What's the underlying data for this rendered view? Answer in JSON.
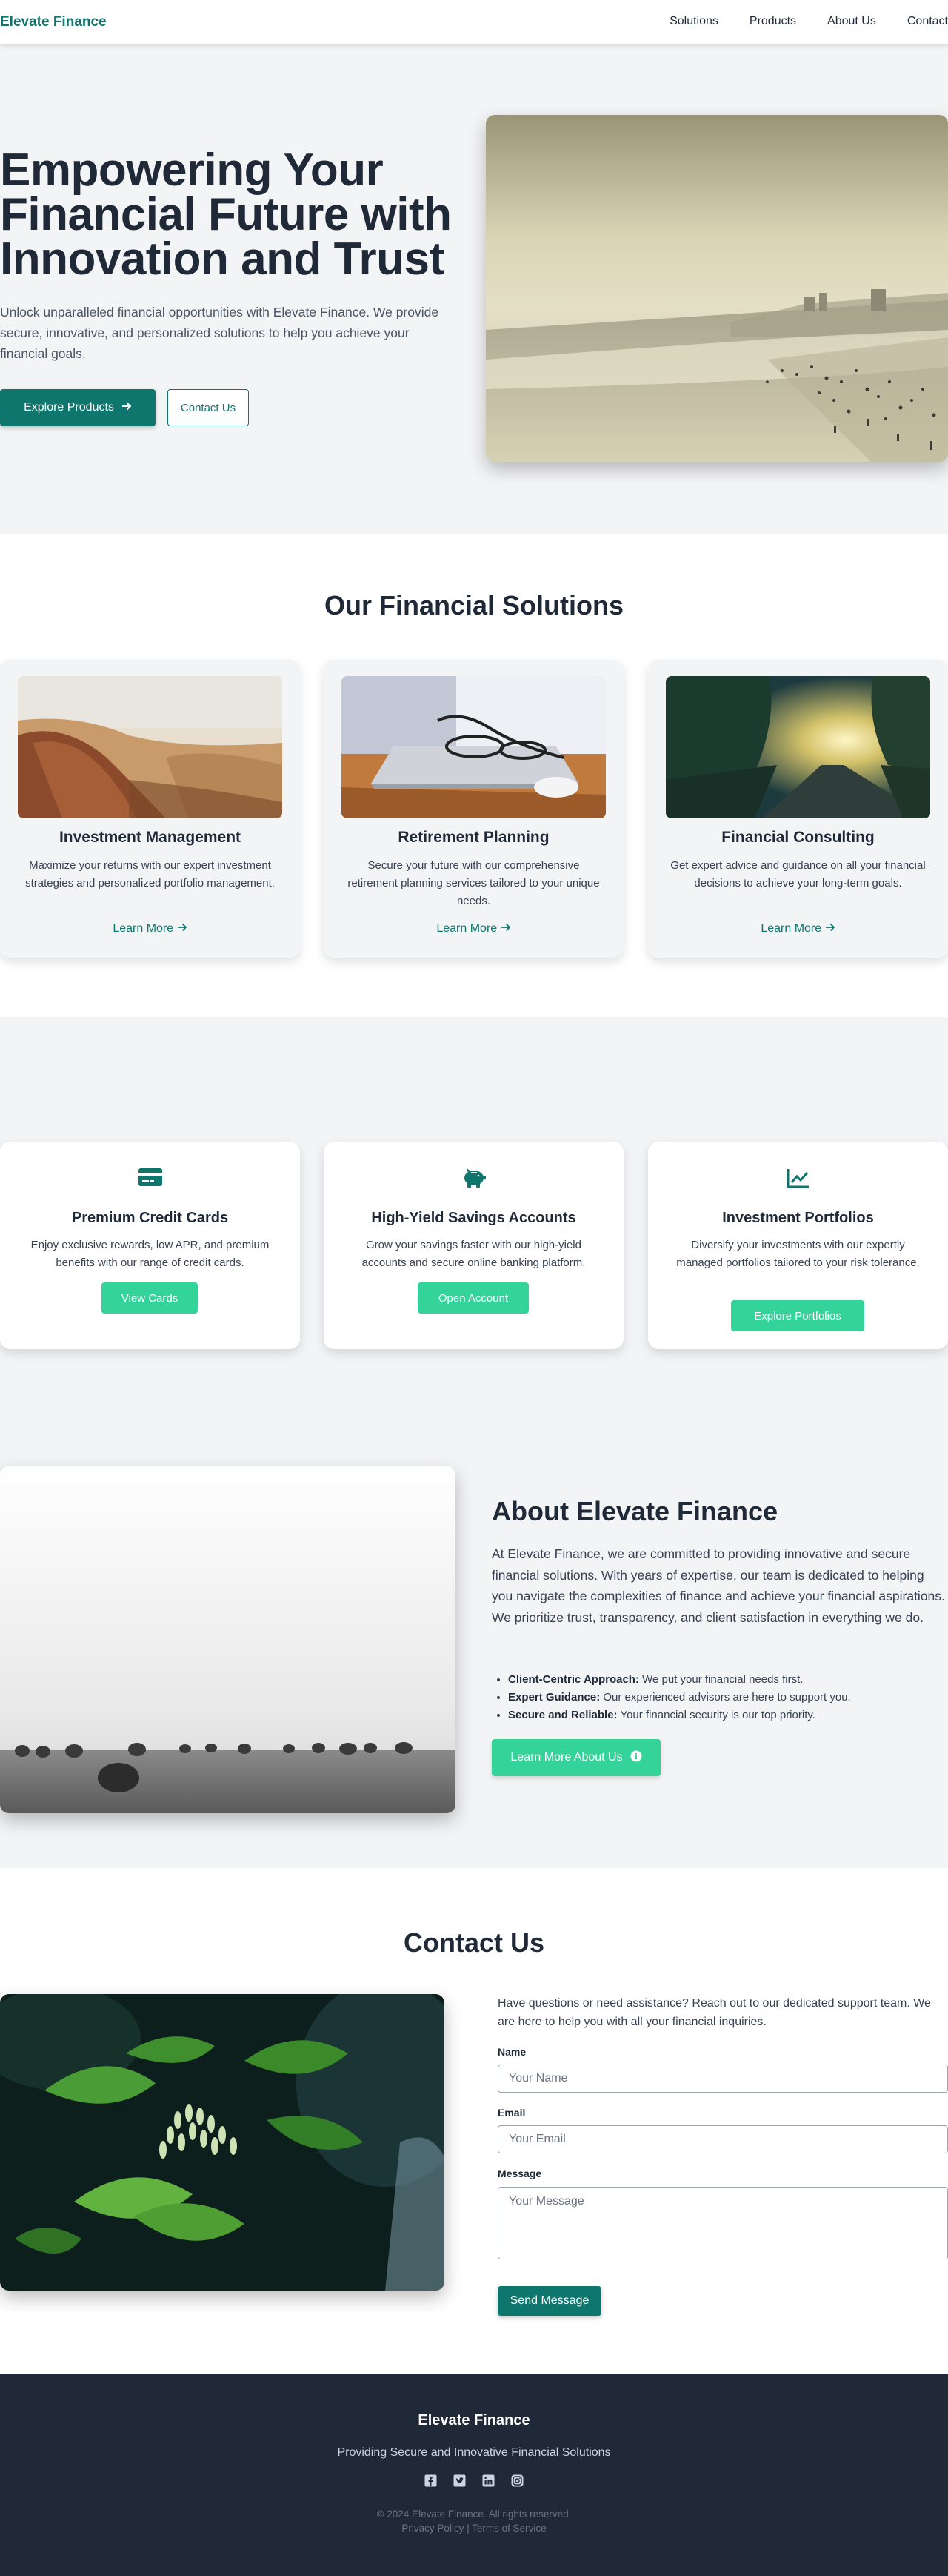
{
  "nav": {
    "brand": "Elevate Finance",
    "links": [
      "Solutions",
      "Products",
      "About Us",
      "Contact"
    ]
  },
  "hero": {
    "title": "Empowering Your Financial Future with Innovation and Trust",
    "subtitle": "Unlock unparalleled financial opportunities with Elevate Finance. We provide secure, innovative, and personalized solutions to help you achieve your financial goals.",
    "primary_button": "Explore Products",
    "secondary_button": "Contact Us"
  },
  "solutions": {
    "title": "Our Financial Solutions",
    "cards": [
      {
        "title": "Investment Management",
        "text": "Maximize your returns with our expert investment strategies and personalized portfolio management.",
        "link": "Learn More"
      },
      {
        "title": "Retirement Planning",
        "text": "Secure your future with our comprehensive retirement planning services tailored to your unique needs.",
        "link": "Learn More"
      },
      {
        "title": "Financial Consulting",
        "text": "Get expert advice and guidance on all your financial decisions to achieve your long-term goals.",
        "link": "Learn More"
      }
    ]
  },
  "products": {
    "cards": [
      {
        "icon": "credit-card-icon",
        "title": "Premium Credit Cards",
        "text": "Enjoy exclusive rewards, low APR, and premium benefits with our range of credit cards.",
        "button": "View Cards"
      },
      {
        "icon": "piggy-bank-icon",
        "title": "High-Yield Savings Accounts",
        "text": "Grow your savings faster with our high-yield accounts and secure online banking platform.",
        "button": "Open Account"
      },
      {
        "icon": "chart-line-icon",
        "title": "Investment Portfolios",
        "text": "Diversify your investments with our expertly managed portfolios tailored to your risk tolerance.",
        "button": "Explore Portfolios"
      }
    ]
  },
  "about": {
    "title": "About Elevate Finance",
    "text": "At Elevate Finance, we are committed to providing innovative and secure financial solutions. With years of expertise, our team is dedicated to helping you navigate the complexities of finance and achieve your financial aspirations. We prioritize trust, transparency, and client satisfaction in everything we do.",
    "points": [
      {
        "label": "Client-Centric Approach:",
        "text": " We put your financial needs first."
      },
      {
        "label": "Expert Guidance:",
        "text": " Our experienced advisors are here to support you."
      },
      {
        "label": "Secure and Reliable:",
        "text": " Your financial security is our top priority."
      }
    ],
    "button": "Learn More About Us"
  },
  "contact": {
    "title": "Contact Us",
    "intro": "Have questions or need assistance? Reach out to our dedicated support team. We are here to help you with all your financial inquiries.",
    "name_label": "Name",
    "name_placeholder": "Your Name",
    "email_label": "Email",
    "email_placeholder": "Your Email",
    "message_label": "Message",
    "message_placeholder": "Your Message",
    "submit": "Send Message"
  },
  "footer": {
    "brand": "Elevate Finance",
    "tagline": "Providing Secure and Innovative Financial Solutions",
    "social": [
      "facebook-icon",
      "twitter-icon",
      "linkedin-icon",
      "instagram-icon"
    ],
    "copyright": "© 2024 Elevate Finance. All rights reserved.",
    "privacy": "Privacy Policy",
    "terms": "Terms of Service",
    "separator": " | "
  },
  "colors": {
    "brand": "#0f766e",
    "accent": "#34d399",
    "dark": "#1f2937",
    "background": "#f3f4f6"
  }
}
